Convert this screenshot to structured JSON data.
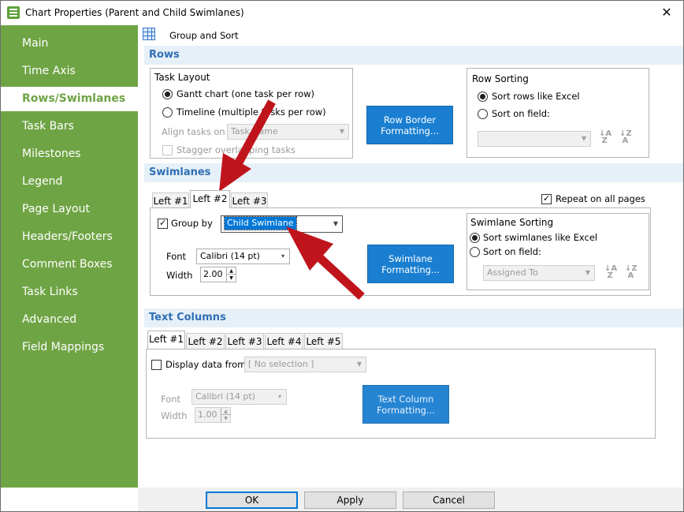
{
  "window": {
    "title": "Chart Properties (Parent and Child Swimlanes)",
    "close_glyph": "✕"
  },
  "sidebar": {
    "items": [
      {
        "label": "Main"
      },
      {
        "label": "Time Axis"
      },
      {
        "label": "Rows/Swimlanes"
      },
      {
        "label": "Task Bars"
      },
      {
        "label": "Milestones"
      },
      {
        "label": "Legend"
      },
      {
        "label": "Page Layout"
      },
      {
        "label": "Headers/Footers"
      },
      {
        "label": "Comment Boxes"
      },
      {
        "label": "Task Links"
      },
      {
        "label": "Advanced"
      },
      {
        "label": "Field Mappings"
      }
    ],
    "active_index": 2,
    "bg_color": "#6fa444"
  },
  "toolbar": {
    "group_sort_label": "Group and Sort",
    "icon": "table-grid-icon"
  },
  "rows": {
    "header": "Rows",
    "task_layout": {
      "title": "Task Layout",
      "option_gantt": "Gantt chart (one task per row)",
      "option_timeline": "Timeline (multiple tasks per row)",
      "align_label": "Align tasks on",
      "align_value": "Task Name",
      "stagger_label": "Stagger overlapping tasks"
    },
    "row_border_button": "Row Border Formatting...",
    "row_sorting": {
      "title": "Row Sorting",
      "option_excel": "Sort rows like Excel",
      "option_field": "Sort on field:",
      "field_value": ""
    }
  },
  "swimlanes": {
    "header": "Swimlanes",
    "tabs": [
      "Left #1",
      "Left #2",
      "Left #3"
    ],
    "active_tab": 1,
    "repeat_label": "Repeat on all pages",
    "group_by_label": "Group by",
    "group_by_value": "Child Swimlane",
    "font_label": "Font",
    "font_value": "Calibri (14 pt)",
    "width_label": "Width",
    "width_value": "2.00",
    "formatting_button": "Swimlane Formatting...",
    "sorting": {
      "title": "Swimlane Sorting",
      "option_excel": "Sort swimlanes like Excel",
      "option_field": "Sort on field:",
      "field_value": "Assigned To"
    }
  },
  "text_columns": {
    "header": "Text Columns",
    "tabs": [
      "Left #1",
      "Left #2",
      "Left #3",
      "Left #4",
      "Left #5"
    ],
    "active_tab": 0,
    "display_label": "Display data from",
    "display_value": "[ No selection ]",
    "font_label": "Font",
    "font_value": "Calibri (14 pt)",
    "width_label": "Width",
    "width_value": "1.00",
    "formatting_button": "Text Column Formatting..."
  },
  "buttons": {
    "ok": "OK",
    "apply": "Apply",
    "cancel": "Cancel"
  },
  "colors": {
    "accent_blue": "#1a7fd1",
    "section_text": "#2f6fb5",
    "annotation_arrow": "#c0141c"
  }
}
